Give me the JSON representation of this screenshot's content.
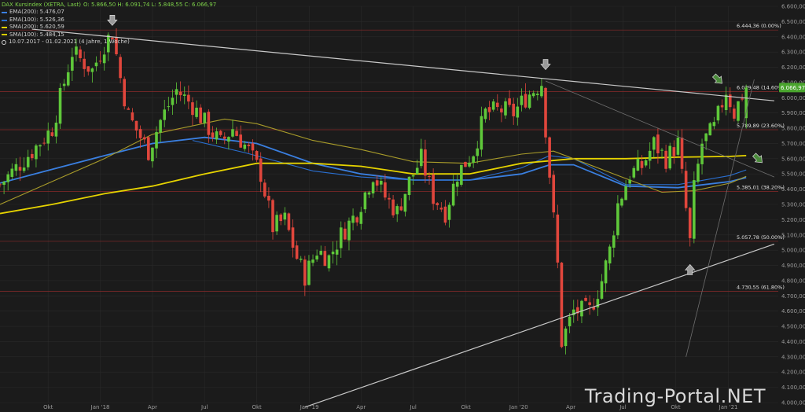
{
  "legend": {
    "title": "DAX Kursindex (XETRA, Last)",
    "ohlc": "O: 5.866,50  H: 6.091,74  L: 5.848,55  C: 6.066,97",
    "indicators": [
      {
        "name": "EMA(200)",
        "value": "5.476,07",
        "color": "#3a7fe0"
      },
      {
        "name": "EMA(100)",
        "value": "5.526,36",
        "color": "#2a6fd0"
      },
      {
        "name": "SMA(200)",
        "value": "5.620,59",
        "color": "#e6d300"
      },
      {
        "name": "SMA(100)",
        "value": "5.484,15",
        "color": "#d8cc00"
      }
    ],
    "period": "10.07.2017 - 01.02.2021  (4 Jahre, 1 Woche)"
  },
  "watermark": "Trading-Portal.NET",
  "colors": {
    "background": "#1b1b1b",
    "up": "#5fc83a",
    "down": "#e0463c",
    "grid": "#2a2a2a",
    "fib_line": "#8a2a2a"
  },
  "chart_data": {
    "type": "candlestick",
    "title": "DAX Kursindex (XETRA, Last)",
    "timeframe": "weekly",
    "ylim": [
      4000,
      6600
    ],
    "y_ticks": [
      "6.600,00",
      "6.500,00",
      "6.400,00",
      "6.300,00",
      "6.200,00",
      "6.100,00",
      "6.000,00",
      "5.900,00",
      "5.800,00",
      "5.700,00",
      "5.600,00",
      "5.500,00",
      "5.400,00",
      "5.300,00",
      "5.200,00",
      "5.100,00",
      "5.000,00",
      "4.900,00",
      "4.800,00",
      "4.700,00",
      "4.600,00",
      "4.500,00",
      "4.400,00",
      "4.300,00",
      "4.200,00",
      "4.100,00",
      "4.000,00"
    ],
    "y_tick_values": [
      6600,
      6500,
      6400,
      6300,
      6200,
      6100,
      6000,
      5900,
      5800,
      5700,
      5600,
      5500,
      5400,
      5300,
      5200,
      5100,
      5000,
      4900,
      4800,
      4700,
      4600,
      4500,
      4400,
      4300,
      4200,
      4100,
      4000
    ],
    "x_ticks": [
      {
        "label": "Okt",
        "x": "2017-10-02"
      },
      {
        "label": "Jan '18",
        "x": "2018-01-01"
      },
      {
        "label": "Apr",
        "x": "2018-04-02"
      },
      {
        "label": "Jul",
        "x": "2018-07-02"
      },
      {
        "label": "Okt",
        "x": "2018-10-01"
      },
      {
        "label": "Jan '19",
        "x": "2019-01-01"
      },
      {
        "label": "Apr",
        "x": "2019-04-01"
      },
      {
        "label": "Jul",
        "x": "2019-07-01"
      },
      {
        "label": "Okt",
        "x": "2019-10-01"
      },
      {
        "label": "Jan '20",
        "x": "2020-01-01"
      },
      {
        "label": "Apr",
        "x": "2020-04-01"
      },
      {
        "label": "Jul",
        "x": "2020-07-01"
      },
      {
        "label": "Okt",
        "x": "2020-10-01"
      },
      {
        "label": "Jan '21",
        "x": "2021-01-01"
      }
    ],
    "x_range": [
      "2017-07-10",
      "2021-03-29"
    ],
    "close_path": [
      [
        "2017-07-10",
        5430
      ],
      [
        "2017-09-04",
        5650
      ],
      [
        "2017-10-09",
        5800
      ],
      [
        "2017-11-13",
        6300
      ],
      [
        "2017-12-18",
        6180
      ],
      [
        "2018-01-08",
        6350
      ],
      [
        "2018-01-22",
        6430
      ],
      [
        "2018-02-05",
        6130
      ],
      [
        "2018-02-19",
        5880
      ],
      [
        "2018-03-26",
        5650
      ],
      [
        "2018-04-16",
        5850
      ],
      [
        "2018-05-14",
        6050
      ],
      [
        "2018-06-11",
        5950
      ],
      [
        "2018-07-09",
        5800
      ],
      [
        "2018-07-30",
        5700
      ],
      [
        "2018-08-20",
        5800
      ],
      [
        "2018-09-17",
        5650
      ],
      [
        "2018-10-08",
        5500
      ],
      [
        "2018-10-29",
        5150
      ],
      [
        "2018-11-19",
        5200
      ],
      [
        "2018-12-10",
        4950
      ],
      [
        "2018-12-24",
        4830
      ],
      [
        "2019-01-14",
        5000
      ],
      [
        "2019-02-04",
        4950
      ],
      [
        "2019-02-25",
        5100
      ],
      [
        "2019-03-25",
        5250
      ],
      [
        "2019-04-22",
        5500
      ],
      [
        "2019-05-13",
        5350
      ],
      [
        "2019-06-03",
        5250
      ],
      [
        "2019-06-24",
        5450
      ],
      [
        "2019-07-15",
        5600
      ],
      [
        "2019-08-05",
        5350
      ],
      [
        "2019-08-26",
        5250
      ],
      [
        "2019-09-16",
        5500
      ],
      [
        "2019-10-14",
        5650
      ],
      [
        "2019-11-04",
        5900
      ],
      [
        "2019-12-02",
        5920
      ],
      [
        "2019-12-23",
        5900
      ],
      [
        "2020-01-13",
        6000
      ],
      [
        "2020-02-10",
        6100
      ],
      [
        "2020-02-24",
        5500
      ],
      [
        "2020-03-09",
        4900
      ],
      [
        "2020-03-16",
        4400
      ],
      [
        "2020-04-06",
        4600
      ],
      [
        "2020-05-04",
        4600
      ],
      [
        "2020-05-25",
        4800
      ],
      [
        "2020-06-08",
        5000
      ],
      [
        "2020-06-22",
        5300
      ],
      [
        "2020-07-13",
        5500
      ],
      [
        "2020-08-03",
        5550
      ],
      [
        "2020-08-24",
        5700
      ],
      [
        "2020-09-14",
        5600
      ],
      [
        "2020-10-05",
        5700
      ],
      [
        "2020-10-26",
        5050
      ],
      [
        "2020-11-02",
        5400
      ],
      [
        "2020-11-16",
        5700
      ],
      [
        "2020-12-07",
        5800
      ],
      [
        "2020-12-28",
        6050
      ],
      [
        "2021-01-11",
        5900
      ],
      [
        "2021-01-25",
        6020
      ],
      [
        "2021-02-01",
        6066.97
      ]
    ],
    "last": {
      "open": 5866.5,
      "high": 6091.74,
      "low": 5848.55,
      "close": 6066.97,
      "label": "6.066,97"
    },
    "fibonacci": [
      {
        "label": "6.444,36 (0.00%)",
        "value": 6444.36
      },
      {
        "label": "6.039,48 (14.60%)",
        "value": 6039.48
      },
      {
        "label": "5.789,89 (23.60%)",
        "value": 5789.89
      },
      {
        "label": "5.385,01 (38.20%)",
        "value": 5385.01
      },
      {
        "label": "5.057,78 (50.00%)",
        "value": 5057.78
      },
      {
        "label": "4.730,55 (61.80%)",
        "value": 4730.55
      }
    ],
    "trendlines": [
      {
        "name": "upper-resistance",
        "from": [
          "2017-09-04",
          6450
        ],
        "to": [
          "2021-03-22",
          5980
        ]
      },
      {
        "name": "lower-support",
        "from": [
          "2018-12-24",
          3970
        ],
        "to": [
          "2021-03-22",
          5040
        ]
      },
      {
        "name": "diagonal-down",
        "from": [
          "2020-02-17",
          6110
        ],
        "to": [
          "2021-03-22",
          5480
        ]
      },
      {
        "name": "steep-up",
        "from": [
          "2020-10-19",
          4300
        ],
        "to": [
          "2021-02-15",
          6120
        ]
      }
    ],
    "moving_averages": [
      {
        "name": "EMA(200)",
        "color": "#3a7fe0",
        "points": [
          [
            "2017-07-10",
            5440
          ],
          [
            "2017-10-09",
            5530
          ],
          [
            "2018-01-08",
            5620
          ],
          [
            "2018-04-02",
            5700
          ],
          [
            "2018-07-02",
            5740
          ],
          [
            "2018-10-01",
            5700
          ],
          [
            "2019-01-07",
            5570
          ],
          [
            "2019-04-01",
            5500
          ],
          [
            "2019-07-01",
            5460
          ],
          [
            "2019-10-07",
            5460
          ],
          [
            "2020-01-06",
            5500
          ],
          [
            "2020-02-24",
            5560
          ],
          [
            "2020-04-06",
            5560
          ],
          [
            "2020-07-06",
            5420
          ],
          [
            "2020-10-05",
            5410
          ],
          [
            "2021-01-04",
            5450
          ],
          [
            "2021-02-01",
            5476.07
          ]
        ]
      },
      {
        "name": "EMA(100)",
        "color": "#2a6fd0",
        "points": [
          [
            "2018-06-11",
            5720
          ],
          [
            "2018-09-10",
            5640
          ],
          [
            "2019-01-07",
            5520
          ],
          [
            "2019-04-01",
            5480
          ],
          [
            "2019-07-01",
            5460
          ],
          [
            "2019-10-07",
            5460
          ],
          [
            "2020-01-06",
            5540
          ],
          [
            "2020-02-24",
            5620
          ],
          [
            "2020-04-06",
            5600
          ],
          [
            "2020-07-06",
            5430
          ],
          [
            "2020-10-05",
            5430
          ],
          [
            "2021-01-04",
            5490
          ],
          [
            "2021-02-01",
            5526.36
          ]
        ]
      },
      {
        "name": "SMA(200)",
        "color": "#e6d300",
        "points": [
          [
            "2017-07-10",
            5240
          ],
          [
            "2017-10-09",
            5300
          ],
          [
            "2018-01-08",
            5370
          ],
          [
            "2018-04-02",
            5420
          ],
          [
            "2018-07-02",
            5500
          ],
          [
            "2018-10-01",
            5570
          ],
          [
            "2019-01-07",
            5570
          ],
          [
            "2019-04-01",
            5550
          ],
          [
            "2019-07-01",
            5500
          ],
          [
            "2019-10-07",
            5500
          ],
          [
            "2020-01-06",
            5570
          ],
          [
            "2020-04-06",
            5600
          ],
          [
            "2020-07-06",
            5600
          ],
          [
            "2020-10-05",
            5610
          ],
          [
            "2021-01-04",
            5615
          ],
          [
            "2021-02-01",
            5620.59
          ]
        ]
      },
      {
        "name": "SMA(100)",
        "color": "#a89b2a",
        "points": [
          [
            "2017-07-10",
            5300
          ],
          [
            "2017-10-09",
            5450
          ],
          [
            "2018-01-08",
            5600
          ],
          [
            "2018-04-02",
            5760
          ],
          [
            "2018-08-06",
            5860
          ],
          [
            "2018-10-01",
            5830
          ],
          [
            "2019-01-07",
            5720
          ],
          [
            "2019-04-01",
            5660
          ],
          [
            "2019-07-01",
            5580
          ],
          [
            "2019-10-07",
            5570
          ],
          [
            "2020-01-06",
            5630
          ],
          [
            "2020-03-02",
            5650
          ],
          [
            "2020-06-01",
            5520
          ],
          [
            "2020-09-07",
            5380
          ],
          [
            "2020-11-02",
            5390
          ],
          [
            "2021-01-04",
            5440
          ],
          [
            "2021-02-01",
            5484.15
          ]
        ]
      }
    ],
    "annotations": [
      {
        "type": "arrow-down",
        "x": "2018-01-22",
        "y": 6500,
        "color": "#9a9a9a"
      },
      {
        "type": "arrow-down",
        "x": "2020-02-17",
        "y": 6210,
        "color": "#9a9a9a"
      },
      {
        "type": "arrow-up",
        "x": "2020-10-26",
        "y": 4880,
        "color": "#9a9a9a"
      },
      {
        "type": "arrow-downright",
        "x": "2020-12-14",
        "y": 6120,
        "color": "#4a8a3a"
      },
      {
        "type": "arrow-downright",
        "x": "2021-02-22",
        "y": 5600,
        "color": "#4a8a3a"
      }
    ]
  }
}
